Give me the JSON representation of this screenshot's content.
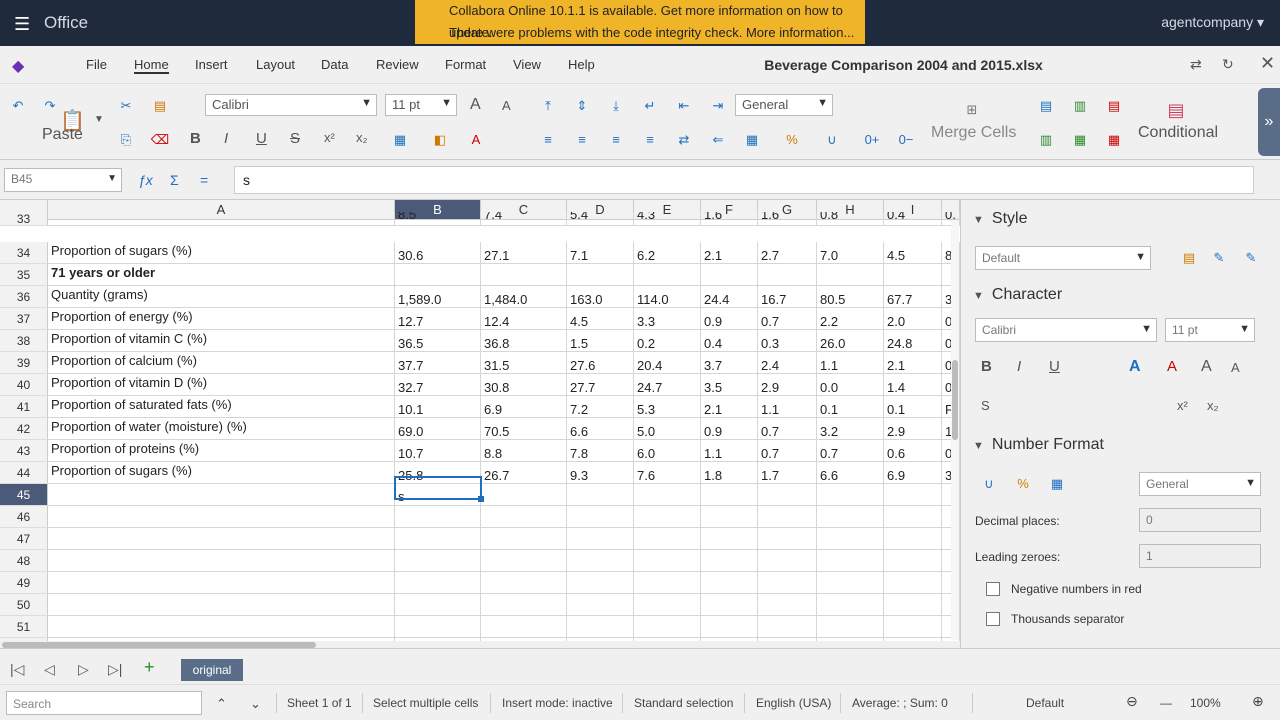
{
  "topbar": {
    "app_title": "Office",
    "notices": [
      "Collabora Online 10.1.1 is available. Get more information on how to update.",
      "There were problems with the code integrity check. More information..."
    ],
    "user": "agentcompany"
  },
  "menu": {
    "items": [
      "File",
      "Home",
      "Insert",
      "Layout",
      "Data",
      "Review",
      "Format",
      "View",
      "Help"
    ],
    "active": "Home",
    "doc_title": "Beverage Comparison 2004 and 2015.xlsx"
  },
  "ribbon": {
    "paste_label": "Paste",
    "font_name": "Calibri",
    "font_size": "11 pt",
    "number_format": "General",
    "merge_label": "Merge Cells",
    "conditional_label": "Conditional"
  },
  "formula_bar": {
    "name_box": "B45",
    "content": "s"
  },
  "grid": {
    "columns": [
      "A",
      "B",
      "C",
      "D",
      "E",
      "F",
      "G",
      "H",
      "I"
    ],
    "selected_column": "B",
    "selected_row": "45",
    "rows": [
      {
        "num": "33",
        "cells": [
          "",
          "8.5",
          "7.4",
          "5.4",
          "4.3",
          "1.6",
          "1.6",
          "0.8",
          "0.4",
          "0."
        ],
        "style": "partial"
      },
      {
        "num": "34",
        "cells": [
          "Proportion of sugars (%)",
          "30.6",
          "27.1",
          "7.1",
          "6.2",
          "2.1",
          "2.7",
          "7.0",
          "4.5",
          "8."
        ]
      },
      {
        "num": "35",
        "cells": [
          "71 years or older",
          "",
          "",
          "",
          "",
          "",
          "",
          "",
          "",
          ""
        ],
        "style": "bold"
      },
      {
        "num": "36",
        "cells": [
          "Quantity (grams)",
          "1,589.0",
          "1,484.0",
          "163.0",
          "114.0",
          "24.4",
          "16.7",
          "80.5",
          "67.7",
          "3"
        ]
      },
      {
        "num": "37",
        "cells": [
          "Proportion of energy (%)",
          "12.7",
          "12.4",
          "4.5",
          "3.3",
          "0.9",
          "0.7",
          "2.2",
          "2.0",
          "0."
        ]
      },
      {
        "num": "38",
        "cells": [
          "Proportion of vitamin C (%)",
          "36.5",
          "36.8",
          "1.5",
          "0.2",
          "0.4",
          "0.3",
          "26.0",
          "24.8",
          "0."
        ]
      },
      {
        "num": "39",
        "cells": [
          "Proportion of calcium (%)",
          "37.7",
          "31.5",
          "27.6",
          "20.4",
          "3.7",
          "2.4",
          "1.1",
          "2.1",
          "0."
        ]
      },
      {
        "num": "40",
        "cells": [
          "Proportion of vitamin D (%)",
          "32.7",
          "30.8",
          "27.7",
          "24.7",
          "3.5",
          "2.9",
          "0.0",
          "1.4",
          "0."
        ]
      },
      {
        "num": "41",
        "cells": [
          "Proportion of saturated fats (%)",
          "10.1",
          "6.9",
          "7.2",
          "5.3",
          "2.1",
          "1.1",
          "0.1",
          "0.1",
          "F"
        ]
      },
      {
        "num": "42",
        "cells": [
          "Proportion of water (moisture) (%)",
          "69.0",
          "70.5",
          "6.6",
          "5.0",
          "0.9",
          "0.7",
          "3.2",
          "2.9",
          "1."
        ]
      },
      {
        "num": "43",
        "cells": [
          "Proportion of proteins (%)",
          "10.7",
          "8.8",
          "7.8",
          "6.0",
          "1.1",
          "0.7",
          "0.7",
          "0.6",
          "0."
        ]
      },
      {
        "num": "44",
        "cells": [
          "Proportion of sugars (%)",
          "25.8",
          "26.7",
          "9.3",
          "7.6",
          "1.8",
          "1.7",
          "6.6",
          "6.9",
          "3."
        ]
      },
      {
        "num": "45",
        "cells": [
          "",
          "s",
          "",
          "",
          "",
          "",
          "",
          "",
          "",
          ""
        ]
      },
      {
        "num": "46",
        "cells": [
          "",
          "",
          "",
          "",
          "",
          "",
          "",
          "",
          "",
          ""
        ]
      },
      {
        "num": "47",
        "cells": [
          "",
          "",
          "",
          "",
          "",
          "",
          "",
          "",
          "",
          ""
        ]
      },
      {
        "num": "48",
        "cells": [
          "",
          "",
          "",
          "",
          "",
          "",
          "",
          "",
          "",
          ""
        ]
      },
      {
        "num": "49",
        "cells": [
          "",
          "",
          "",
          "",
          "",
          "",
          "",
          "",
          "",
          ""
        ]
      },
      {
        "num": "50",
        "cells": [
          "",
          "",
          "",
          "",
          "",
          "",
          "",
          "",
          "",
          ""
        ]
      },
      {
        "num": "51",
        "cells": [
          "",
          "",
          "",
          "",
          "",
          "",
          "",
          "",
          "",
          ""
        ]
      },
      {
        "num": "52",
        "cells": [
          "",
          "",
          "",
          "",
          "",
          "",
          "",
          "",
          "",
          ""
        ]
      }
    ]
  },
  "sidebar": {
    "style_title": "Style",
    "style_value": "Default",
    "character_title": "Character",
    "font_name": "Calibri",
    "font_size": "11 pt",
    "number_format_title": "Number Format",
    "number_format_value": "General",
    "decimal_label": "Decimal places:",
    "decimal_value": "0",
    "leading_label": "Leading zeroes:",
    "leading_value": "1",
    "negative_red": "Negative numbers in red",
    "thousands_sep": "Thousands separator"
  },
  "sheets": {
    "tabs": [
      "original"
    ],
    "active": "original"
  },
  "status": {
    "search_placeholder": "Search",
    "sheet_info": "Sheet 1 of 1",
    "selection_mode": "Select multiple cells",
    "insert_mode": "Insert mode: inactive",
    "selection_type": "Standard selection",
    "language": "English (USA)",
    "summary": "Average: ; Sum: 0",
    "cell_style": "Default",
    "zoom": "100%"
  }
}
